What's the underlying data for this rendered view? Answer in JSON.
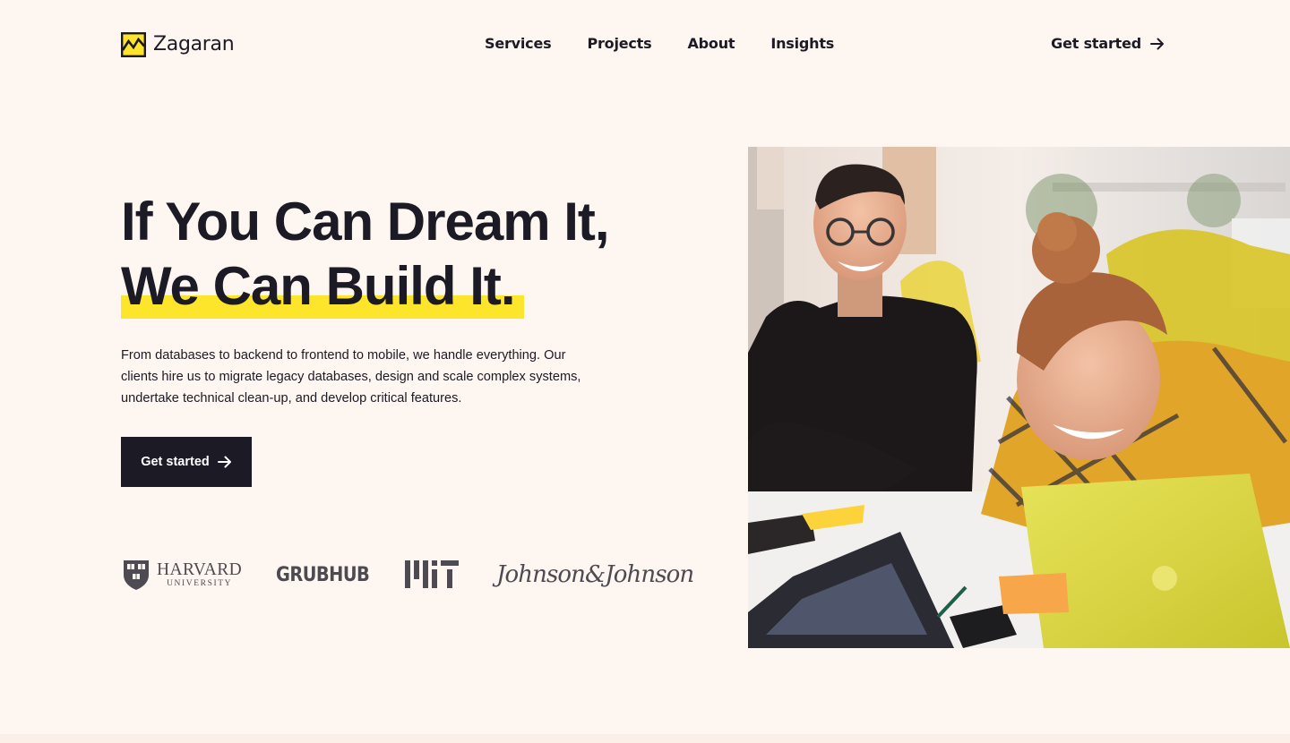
{
  "header": {
    "brand_name": "Zagaran",
    "nav": [
      "Services",
      "Projects",
      "About",
      "Insights"
    ],
    "cta_label": "Get started"
  },
  "hero": {
    "title_line_1": "If You Can Dream It,",
    "title_line_2": "We Can Build It.",
    "description": "From databases to backend to frontend to mobile, we handle everything. Our clients hire us to migrate legacy databases, design and scale complex systems, undertake technical clean-up, and develop critical features.",
    "cta_label": "Get started",
    "image_icon": "team-at-laptops-photo"
  },
  "clients": {
    "harvard": {
      "name": "HARVARD",
      "sub": "UNIVERSITY",
      "icon": "harvard-shield-icon"
    },
    "grubhub": "GRUBHUB",
    "mit": {
      "wordmark": "MIT",
      "icon": "mit-logo-icon"
    },
    "jnj": "Johnson&Johnson"
  },
  "colors": {
    "background": "#fef6f0",
    "text": "#1c1a24",
    "accent_yellow": "#fde52c",
    "logo_gray": "#4d4a52"
  },
  "icons": {
    "logo_mark": "mountain-logo-icon",
    "arrow": "arrow-right-icon"
  }
}
